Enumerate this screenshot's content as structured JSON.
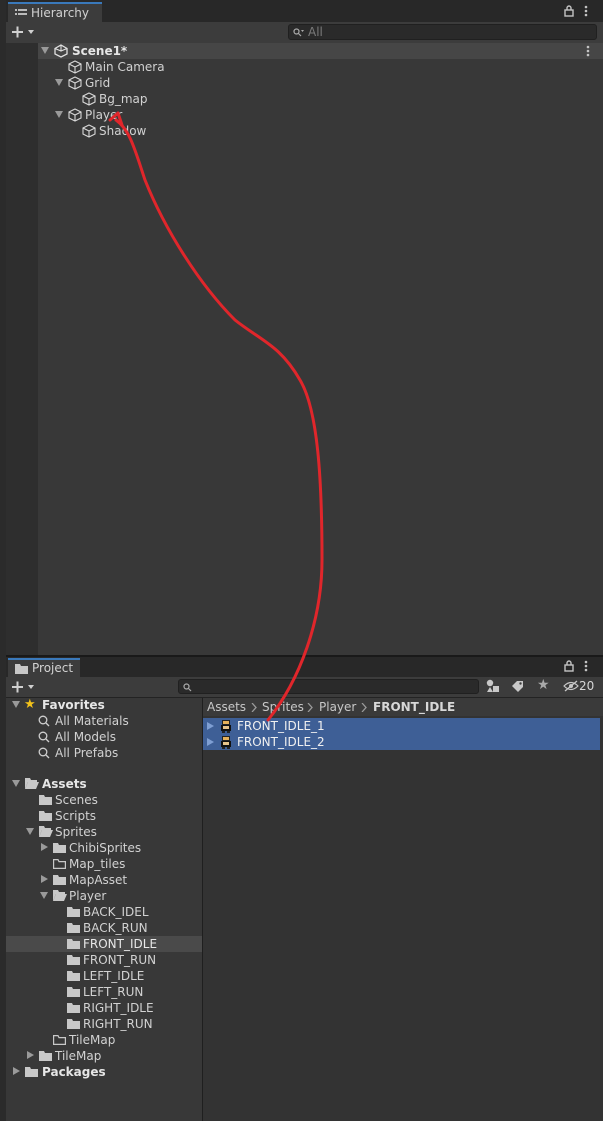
{
  "hierarchy": {
    "tab_label": "Hierarchy",
    "search_placeholder": "All",
    "scene_name": "Scene1*",
    "items": [
      {
        "label": "Main Camera"
      },
      {
        "label": "Grid"
      },
      {
        "label": "Bg_map"
      },
      {
        "label": "Player"
      },
      {
        "label": "Shadow"
      }
    ]
  },
  "project": {
    "tab_label": "Project",
    "hidden_count": "20",
    "favorites": {
      "label": "Favorites",
      "items": [
        "All Materials",
        "All Models",
        "All Prefabs"
      ]
    },
    "assets_label": "Assets",
    "folders": {
      "scenes": "Scenes",
      "scripts": "Scripts",
      "sprites": "Sprites",
      "chibi": "ChibiSprites",
      "map_tiles": "Map_tiles",
      "mapasset": "MapAsset",
      "player": "Player",
      "player_children": [
        "BACK_IDEL",
        "BACK_RUN",
        "FRONT_IDLE",
        "FRONT_RUN",
        "LEFT_IDLE",
        "LEFT_RUN",
        "RIGHT_IDLE",
        "RIGHT_RUN"
      ],
      "tilemap_inner": "TileMap",
      "tilemap": "TileMap",
      "packages": "Packages"
    },
    "breadcrumb": [
      "Assets",
      "Sprites",
      "Player",
      "FRONT_IDLE"
    ],
    "files": [
      "FRONT_IDLE_1",
      "FRONT_IDLE_2"
    ]
  },
  "colors": {
    "selection": "#3e5f96",
    "annotation_arrow": "#e0262b",
    "tab_accent": "#3a79bb"
  }
}
